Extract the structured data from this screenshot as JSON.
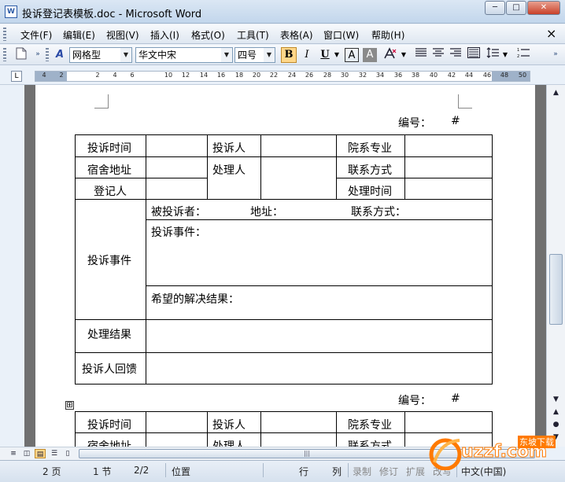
{
  "window": {
    "title": "投诉登记表模板.doc - Microsoft Word",
    "app_icon": "W",
    "minimize": "─",
    "maximize": "□",
    "close": "✕"
  },
  "menu": {
    "items": [
      "文件(F)",
      "编辑(E)",
      "视图(V)",
      "插入(I)",
      "格式(O)",
      "工具(T)",
      "表格(A)",
      "窗口(W)",
      "帮助(H)"
    ],
    "close_doc": "×"
  },
  "format_toolbar": {
    "style": "网格型",
    "font": "华文中宋",
    "size": "四号",
    "bold": "B",
    "italic": "I",
    "underline": "U",
    "char_border": "A",
    "char_shading": "A"
  },
  "ruler": {
    "numbers": [
      "4",
      "2",
      "2",
      "4",
      "6",
      "10",
      "12",
      "14",
      "16",
      "18",
      "20",
      "22",
      "24",
      "26",
      "28",
      "30",
      "32",
      "34",
      "36",
      "38",
      "40",
      "42",
      "44",
      "46",
      "48",
      "50"
    ]
  },
  "document": {
    "serial_label": "编号：",
    "serial_value": "#",
    "table1": {
      "complaint_time": "投诉时间",
      "complainant": "投诉人",
      "department_major": "院系专业",
      "dorm_address": "宿舍地址",
      "handler": "处理人",
      "contact": "联系方式",
      "registrar": "登记人",
      "handle_time": "处理时间",
      "complaint_matter": "投诉事件",
      "respondent": "被投诉者：",
      "address": "地址：",
      "contact2": "联系方式：",
      "matter_detail": "投诉事件：",
      "desired_result": "希望的解决结果：",
      "handle_result": "处理结果",
      "feedback": "投诉人回馈"
    },
    "table2_anchor": "⊞",
    "table2": {
      "complaint_time": "投诉时间",
      "complainant": "投诉人",
      "department_major": "院系专业",
      "dorm_address": "宿舍地址",
      "handler": "处理人",
      "contact": "联系方式"
    }
  },
  "statusbar": {
    "page": "2 页",
    "section": "1 节",
    "page_of": "2/2",
    "position": "位置",
    "line": "行",
    "column": "列",
    "record": "录制",
    "revise": "修订",
    "extend": "扩展",
    "overwrite": "改写",
    "language": "中文(中国)"
  },
  "watermark": {
    "brand": "uzzf.com",
    "tag": "东坡下载"
  },
  "colors": {
    "titlebar": "#c2d6ec",
    "toolbar": "#dfe7f1",
    "bold_active": "#ffd78a",
    "watermark_orange": "#ff7a00"
  }
}
